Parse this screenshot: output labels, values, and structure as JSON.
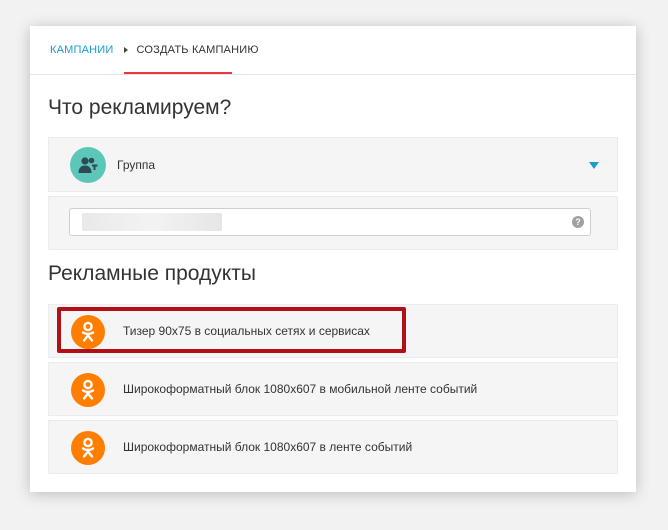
{
  "breadcrumb": {
    "campaigns": "КАМПАНИИ",
    "current": "СОЗДАТЬ КАМПАНИЮ"
  },
  "advertise": {
    "heading": "Что рекламируем?",
    "object_type": "Группа",
    "url_value": "",
    "help_glyph": "?"
  },
  "products": {
    "heading": "Рекламные продукты",
    "items": [
      {
        "label": "Тизер 90х75 в социальных сетях и сервисах",
        "icon": "ok-logo-icon",
        "highlighted": true
      },
      {
        "label": "Широкоформатный блок 1080х607 в мобильной ленте событий",
        "icon": "ok-logo-icon",
        "highlighted": false
      },
      {
        "label": "Широкоформатный блок 1080х607 в ленте событий",
        "icon": "ok-logo-icon",
        "highlighted": false
      }
    ]
  },
  "colors": {
    "accent": "#1a9ccf",
    "active_tab_underline": "#e8383d",
    "ok_orange": "#ff7e00",
    "group_teal": "#5cc7b9",
    "highlight": "#b01016"
  }
}
